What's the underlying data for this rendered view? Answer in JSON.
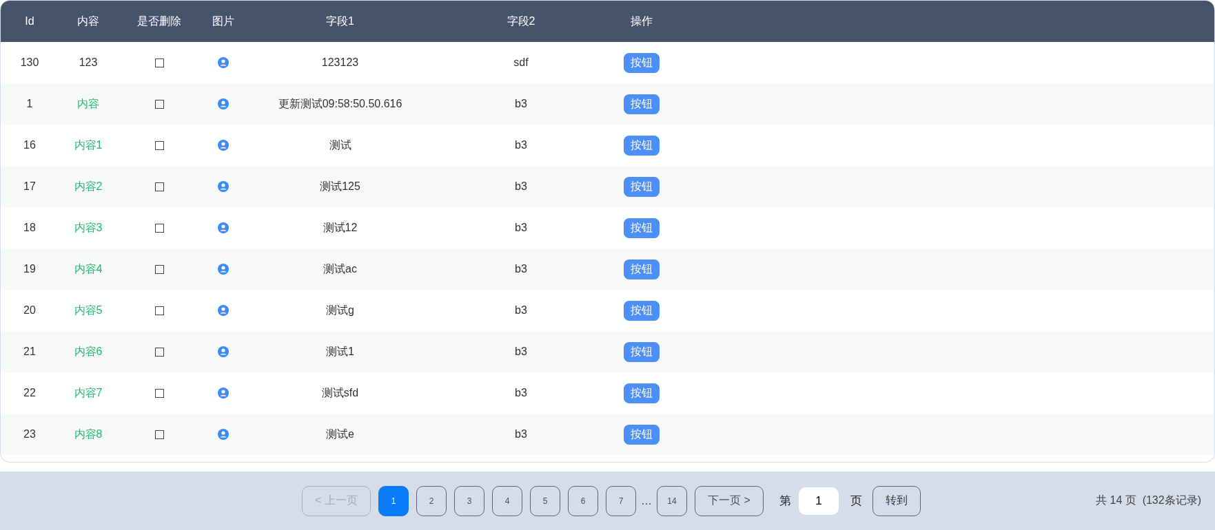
{
  "table": {
    "columns": [
      "Id",
      "内容",
      "是否删除",
      "图片",
      "字段1",
      "字段2",
      "操作"
    ],
    "rows": [
      {
        "id": "130",
        "content": "123",
        "color": "#333333",
        "deleted": false,
        "field1": "123123",
        "field2": "sdf",
        "action": "按钮"
      },
      {
        "id": "1",
        "content": "内容",
        "color": "#19be6b",
        "deleted": false,
        "field1": "更新测试09:58:50.50.616",
        "field2": "b3",
        "action": "按钮"
      },
      {
        "id": "16",
        "content": "内容1",
        "color": "#19be6b",
        "deleted": false,
        "field1": "测试",
        "field2": "b3",
        "action": "按钮"
      },
      {
        "id": "17",
        "content": "内容2",
        "color": "#19be6b",
        "deleted": false,
        "field1": "测试125",
        "field2": "b3",
        "action": "按钮"
      },
      {
        "id": "18",
        "content": "内容3",
        "color": "#19be6b",
        "deleted": false,
        "field1": "测试12",
        "field2": "b3",
        "action": "按钮"
      },
      {
        "id": "19",
        "content": "内容4",
        "color": "#19be6b",
        "deleted": false,
        "field1": "测试ac",
        "field2": "b3",
        "action": "按钮"
      },
      {
        "id": "20",
        "content": "内容5",
        "color": "#19be6b",
        "deleted": false,
        "field1": "测试g",
        "field2": "b3",
        "action": "按钮"
      },
      {
        "id": "21",
        "content": "内容6",
        "color": "#19be6b",
        "deleted": false,
        "field1": "测试1",
        "field2": "b3",
        "action": "按钮"
      },
      {
        "id": "22",
        "content": "内容7",
        "color": "#19be6b",
        "deleted": false,
        "field1": "测试sfd",
        "field2": "b3",
        "action": "按钮"
      },
      {
        "id": "23",
        "content": "内容8",
        "color": "#19be6b",
        "deleted": false,
        "field1": "测试e",
        "field2": "b3",
        "action": "按钮"
      }
    ]
  },
  "pagination": {
    "prev": {
      "label": "< 上一页",
      "disabled": true
    },
    "pages": [
      {
        "label": "1",
        "selected": true
      },
      {
        "label": "2",
        "selected": false
      },
      {
        "label": "3",
        "selected": false
      },
      {
        "label": "4",
        "selected": false
      },
      {
        "label": "5",
        "selected": false
      },
      {
        "label": "6",
        "selected": false
      },
      {
        "label": "7",
        "selected": false
      }
    ],
    "ellipsis": "…",
    "last_page": {
      "label": "14",
      "selected": false
    },
    "next": {
      "label": "下一页 >",
      "disabled": false
    },
    "goto_prefix": "第",
    "goto_value": "1",
    "goto_suffix": "页",
    "goto_button": "转到",
    "summary": "共 14 页  (132条记录)"
  }
}
